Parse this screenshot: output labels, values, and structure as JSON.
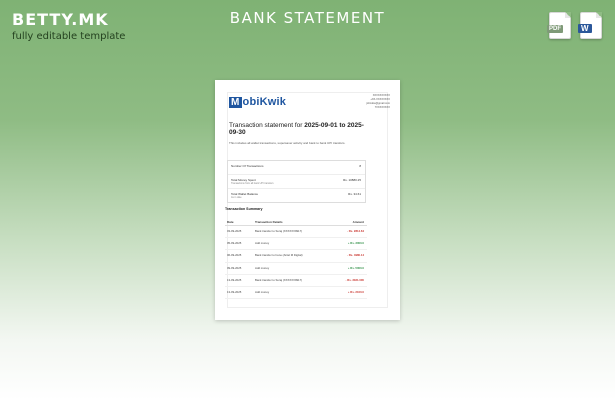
{
  "brand": "BETTY.MK",
  "tagline": "fully editable template",
  "heading": "BANK STATEMENT",
  "file_icons": [
    {
      "label": "PDF"
    },
    {
      "label": "W"
    }
  ],
  "colors": {
    "accent": "#1f56a0",
    "negative": "#c8332c",
    "positive": "#2f8f46"
  },
  "statement": {
    "logo_letter": "M",
    "logo_rest": "obiKwik",
    "contact": [
      "XXXXXXXXXX",
      "+XX-XXXXXXXX",
      "johndoe@gmail.com",
      "7XXXXXXXX"
    ],
    "title_prefix": "Transaction statement for ",
    "title_range": "2025-09-01 to 2025-09-30",
    "subtitle": "This includes all wallet transactions, supersaver activity and bank to bank UPI transfers.",
    "summary_rows": [
      {
        "label": "Number Of Transactions",
        "value": "8",
        "sub": ""
      },
      {
        "label": "Total Money Spent",
        "value": "Rs. 10880.25",
        "sub": "Transactions from all bank UPI transfers"
      },
      {
        "label": "Total Wallet Balance",
        "value": "Rs. 34.61",
        "sub": "As in date"
      }
    ],
    "summary_title": "Transaction Summary",
    "columns": [
      "Date",
      "Transaction Details",
      "Amount"
    ],
    "transactions": [
      {
        "date": "03-09-2025",
        "details": "Bank transfer to Suraj (XXXXXX9917)",
        "amount": "- Rs. 2814.64",
        "type": "neg"
      },
      {
        "date": "05-09-2025",
        "details": "Add money",
        "amount": "+ Rs. 3000.0",
        "type": "pos"
      },
      {
        "date": "06-09-2025",
        "details": "Bank transfer to Irene (Airtel M Digital)",
        "amount": "- Rs. 4980.14",
        "type": "neg"
      },
      {
        "date": "09-09-2025",
        "details": "Add money",
        "amount": "+ Rs. 5000.0",
        "type": "pos"
      },
      {
        "date": "13-09-2025",
        "details": "Bank transfer to Suraj (XXXXXX9917)",
        "amount": "- Rs. 3181.000",
        "type": "neg"
      },
      {
        "date": "13-09-2025",
        "details": "Add money",
        "amount": "+ Rs. 2100.0",
        "type": "pos"
      }
    ]
  }
}
